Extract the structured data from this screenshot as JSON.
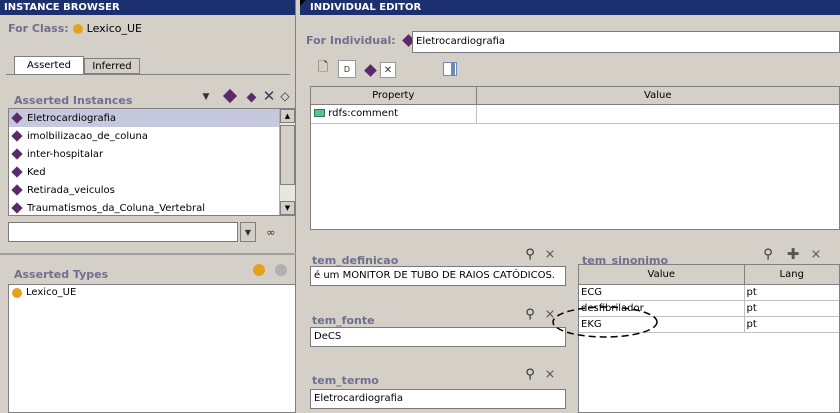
{
  "left": {
    "title": "INSTANCE BROWSER",
    "for_class_label": "For Class:",
    "for_class_value": "Lexico_UE",
    "tabs": [
      {
        "label": "Asserted"
      },
      {
        "label": "Inferred"
      }
    ],
    "asserted_instances_label": "Asserted Instances",
    "instances": [
      {
        "label": "Eletrocardiografia"
      },
      {
        "label": "imolbilizacao_de_coluna"
      },
      {
        "label": "inter-hospitalar"
      },
      {
        "label": "Ked"
      },
      {
        "label": "Retirada_veiculos"
      },
      {
        "label": "Traumatismos_da_Coluna_Vertebral"
      }
    ],
    "asserted_types_label": "Asserted Types",
    "types": [
      {
        "label": "Lexico_UE"
      }
    ]
  },
  "right": {
    "title": "INDIVIDUAL EDITOR",
    "for_individual_label": "For Individual:",
    "for_individual_value": "Eletrocardiografia",
    "property_table": {
      "headers": [
        "Property",
        "Value"
      ],
      "rows": [
        {
          "property": "rdfs:comment",
          "value": ""
        }
      ]
    },
    "tem_definicao": {
      "label": "tem_definicao",
      "value": "é um MONITOR DE TUBO DE RAIOS CATÓDICOS."
    },
    "tem_fonte": {
      "label": "tem_fonte",
      "value": "DeCS"
    },
    "tem_termo": {
      "label": "tem_termo",
      "value": "Eletrocardiografia"
    },
    "tem_sinonimo": {
      "label": "tem_sinonimo",
      "headers": [
        "Value",
        "Lang"
      ],
      "rows": [
        {
          "value": "ECG",
          "lang": "pt"
        },
        {
          "value": "desfibrilador",
          "lang": "pt"
        },
        {
          "value": "EKG",
          "lang": "pt"
        }
      ]
    }
  },
  "colors": {
    "titlebar": "#1c2f6e",
    "selection": "#c6c9dd",
    "class_icon": "#e4a21c",
    "instance_icon": "#5a2a6b",
    "panel_bg": "#d4d0c8"
  }
}
